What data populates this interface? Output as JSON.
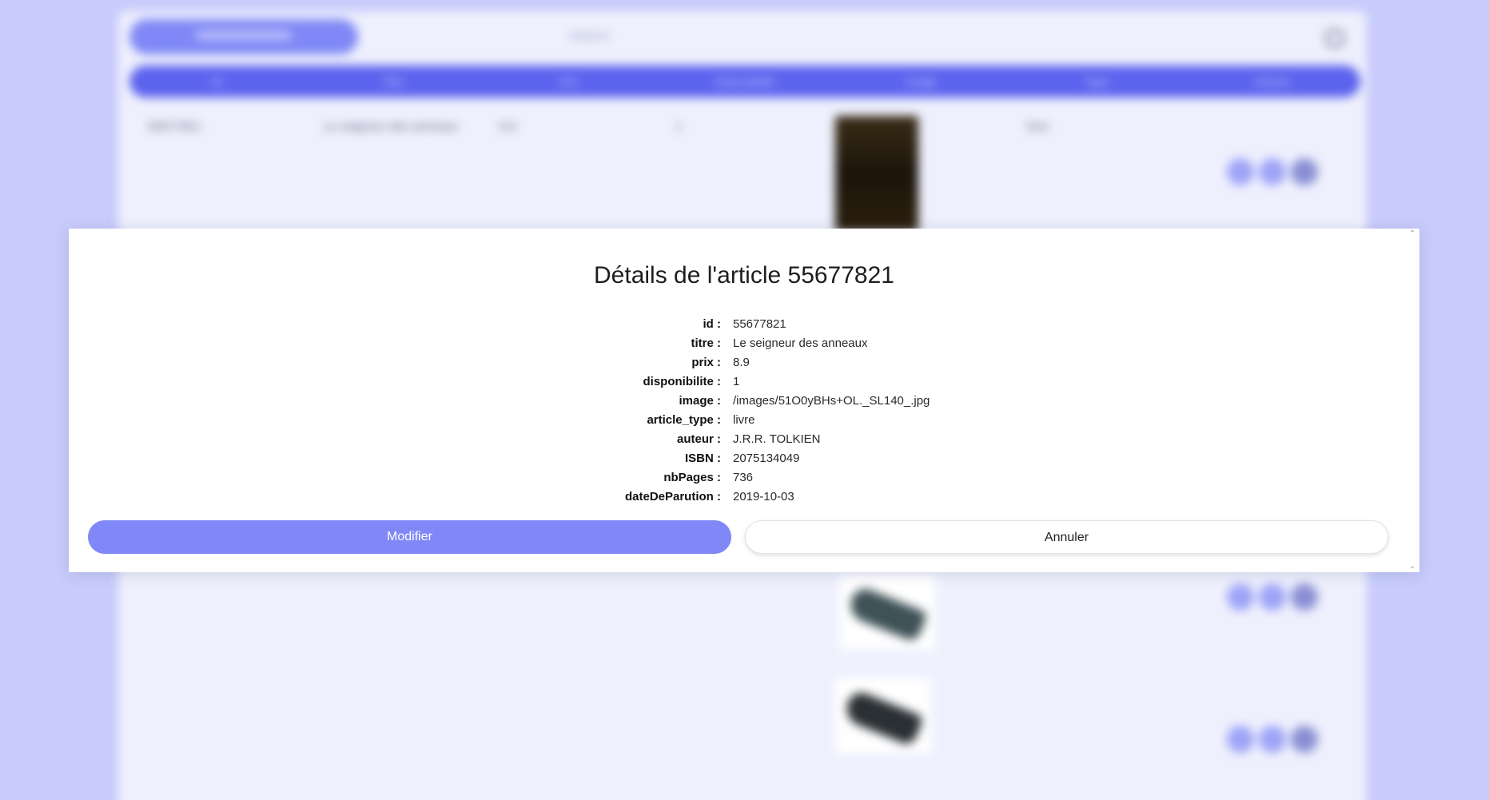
{
  "background": {
    "search_placeholder": "Search",
    "table_headers": [
      "ID",
      "Titre",
      "Prix",
      "Disponibilité",
      "Image",
      "Type",
      "Actions"
    ],
    "rows": [
      {
        "id": "55677821",
        "titre": "Le seigneur des anneaux",
        "prix": "8.9",
        "dispo": "1",
        "type": "livre"
      },
      {
        "id": "",
        "titre": "",
        "prix": "",
        "dispo": "",
        "type": ""
      },
      {
        "id": "",
        "titre": "",
        "prix": "",
        "dispo": "",
        "type": ""
      }
    ]
  },
  "modal": {
    "title": "Détails de l'article 55677821",
    "fields": [
      {
        "key": "id :",
        "value": "55677821"
      },
      {
        "key": "titre :",
        "value": "Le seigneur des anneaux"
      },
      {
        "key": "prix :",
        "value": "8.9"
      },
      {
        "key": "disponibilite :",
        "value": "1"
      },
      {
        "key": "image :",
        "value": "/images/51O0yBHs+OL._SL140_.jpg"
      },
      {
        "key": "article_type :",
        "value": "livre"
      },
      {
        "key": "auteur :",
        "value": "J.R.R. TOLKIEN"
      },
      {
        "key": "ISBN :",
        "value": "2075134049"
      },
      {
        "key": "nbPages :",
        "value": "736"
      },
      {
        "key": "dateDeParution :",
        "value": "2019-10-03"
      }
    ],
    "modifier_label": "Modifier",
    "annuler_label": "Annuler"
  },
  "colors": {
    "accent": "#7f88f6",
    "header_row": "#5c63ee",
    "backdrop": "#c8ccfb"
  },
  "icons": {
    "search": "search-icon",
    "scroll_up": "chevron-up-icon",
    "scroll_down": "chevron-down-icon"
  }
}
